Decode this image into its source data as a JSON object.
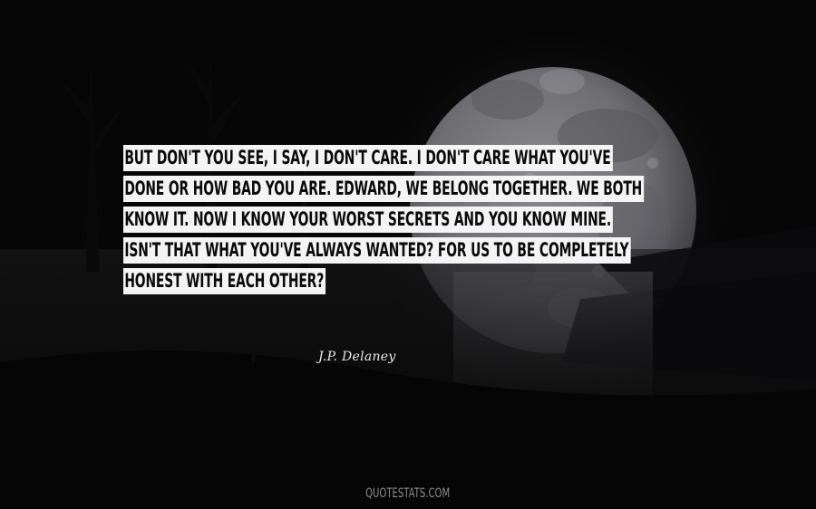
{
  "quote": {
    "lines": [
      "BUT DON'T YOU SEE, I SAY, I DON'T CARE. I DON'T CARE WHAT YOU'VE",
      "DONE OR HOW BAD YOU ARE. EDWARD, WE BELONG TOGETHER. WE BOTH",
      "KNOW IT. NOW I KNOW YOUR WORST SECRETS AND YOU KNOW MINE.",
      "ISN'T THAT WHAT YOU'VE ALWAYS WANTED? FOR US TO BE COMPLETELY",
      "HONEST WITH EACH OTHER?"
    ]
  },
  "author": "J.P. Delaney",
  "watermark": "QUOTESTATS.COM",
  "colors": {
    "background": "#060606",
    "text_highlight": "#f4f4f4",
    "text": "#0a0a0a",
    "moon": "#7c7c80"
  },
  "background_scene": "full-moon-over-dark-water"
}
